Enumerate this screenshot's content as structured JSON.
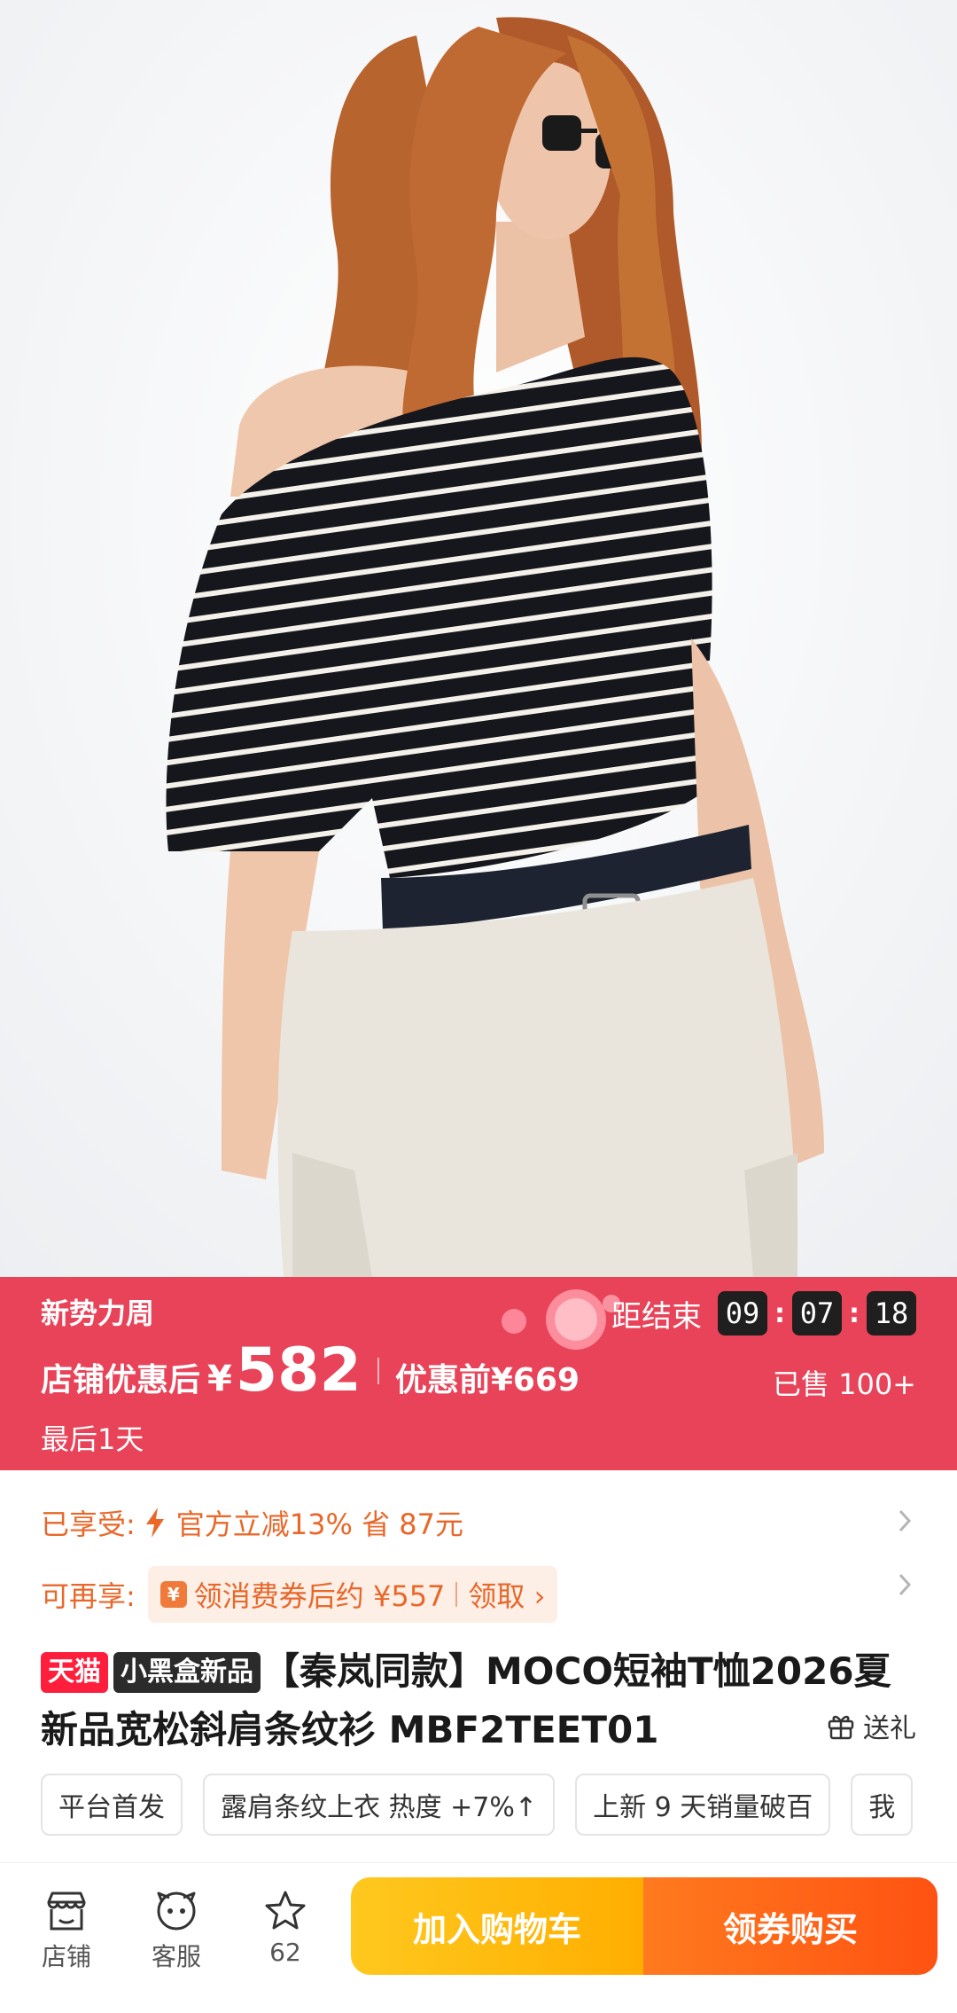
{
  "hero": {
    "image": "model-striped-off-shoulder-tee-photo"
  },
  "promo": {
    "event_name": "新势力周",
    "countdown_label": "距结束",
    "countdown": [
      "09",
      "07",
      "18"
    ],
    "price_label": "店铺优惠后",
    "currency": "¥",
    "price": "582",
    "original_price": "优惠前¥669",
    "sold": "已售 100+",
    "last_day": "最后1天",
    "colors": {
      "banner": "#e84358"
    }
  },
  "benefits": {
    "enjoyed_label": "已享受:",
    "enjoyed_text": "官方立减13% 省 87元",
    "available_label": "可再享:",
    "coupon_icon": "¥",
    "coupon_text": "领消费券后约 ¥557",
    "coupon_action": "领取 ›"
  },
  "product": {
    "tag_tmall": "天猫",
    "tag_blackbox": "小黑盒新品",
    "title": "【秦岚同款】MOCO短袖T恤2026夏新品宽松斜肩条纹衫 MBF2TEET01",
    "gift_label": "送礼"
  },
  "chips": [
    "平台首发",
    "露肩条纹上衣 热度 +7%↑",
    "上新 9 天销量破百",
    "我"
  ],
  "bottom_bar": {
    "store_label": "店铺",
    "service_label": "客服",
    "favorite_count": "62",
    "add_cart": "加入购物车",
    "buy": "领券购买",
    "colors": {
      "cart": "#ffb800",
      "buy": "#ff5a14"
    }
  }
}
